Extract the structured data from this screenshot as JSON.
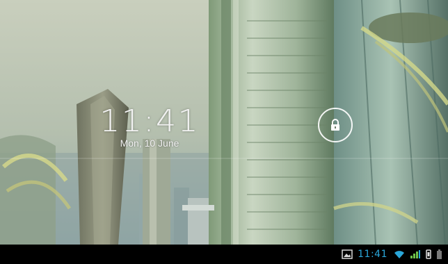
{
  "lockscreen": {
    "time": "11:41",
    "date": "Mon, 10 June",
    "unlock_icon": "lock-icon"
  },
  "status_bar": {
    "time": "11:41",
    "accent_color": "#2aa6d9",
    "background_color": "#000000",
    "icons": [
      "image-notification-icon",
      "wifi-icon",
      "signal-icon",
      "sync-icon",
      "battery-icon"
    ]
  },
  "colors": {
    "clock_text": "#f2f2f2",
    "wallpaper_sky": "#b7c3ac",
    "wallpaper_tower": "#9db596"
  }
}
